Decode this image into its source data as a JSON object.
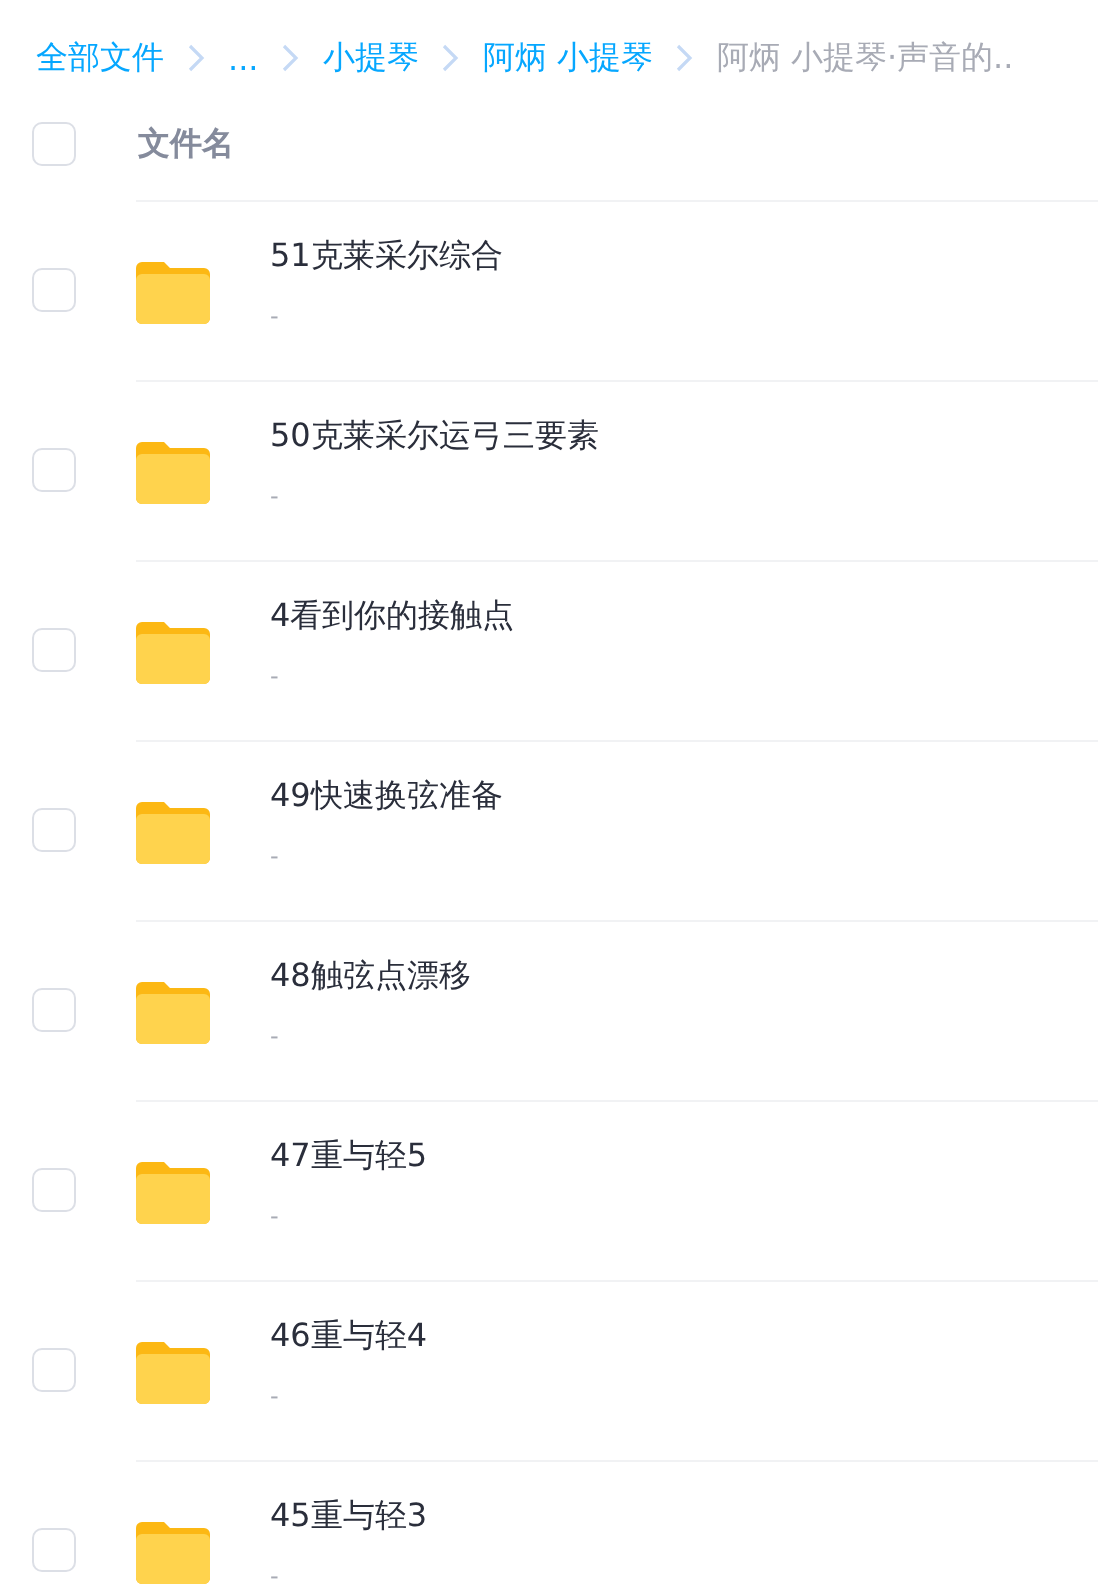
{
  "breadcrumb": [
    {
      "label": "全部文件",
      "selected": false
    },
    {
      "label": "...",
      "selected": false
    },
    {
      "label": "小提琴",
      "selected": false
    },
    {
      "label": "阿炳 小提琴",
      "selected": false
    },
    {
      "label": "阿炳 小提琴·声音的..",
      "selected": true
    }
  ],
  "header": {
    "checked": false,
    "label": "文件名"
  },
  "files": [
    {
      "name": "51克莱采尔综合",
      "meta": "-",
      "checked": false
    },
    {
      "name": "50克莱采尔运弓三要素",
      "meta": "-",
      "checked": false
    },
    {
      "name": "4看到你的接触点",
      "meta": "-",
      "checked": false
    },
    {
      "name": "49快速换弦准备",
      "meta": "-",
      "checked": false
    },
    {
      "name": "48触弦点漂移",
      "meta": "-",
      "checked": false
    },
    {
      "name": "47重与轻5",
      "meta": "-",
      "checked": false
    },
    {
      "name": "46重与轻4",
      "meta": "-",
      "checked": false
    },
    {
      "name": "45重与轻3",
      "meta": "-",
      "checked": false
    }
  ]
}
